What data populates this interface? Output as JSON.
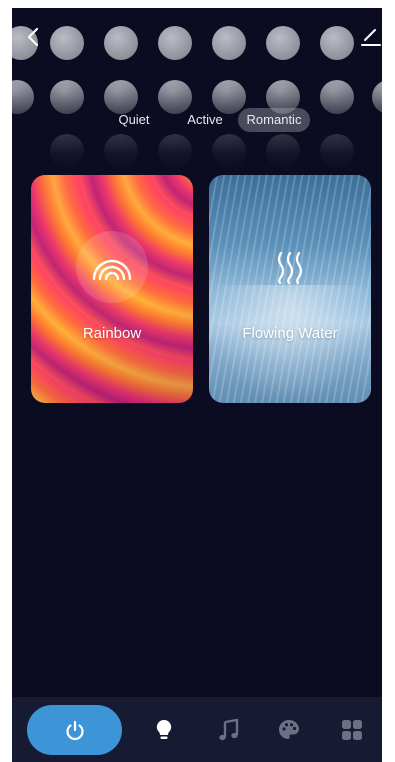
{
  "tabs": [
    {
      "label": "Quiet",
      "selected": false
    },
    {
      "label": "Active",
      "selected": false
    },
    {
      "label": "Romantic",
      "selected": true
    }
  ],
  "scenes": [
    {
      "label": "Rainbow",
      "icon": "rainbow-icon"
    },
    {
      "label": "Flowing Water",
      "icon": "water-waves-icon"
    }
  ],
  "bottom_nav": [
    {
      "name": "power",
      "icon": "power-icon",
      "active": true
    },
    {
      "name": "light",
      "icon": "bulb-icon"
    },
    {
      "name": "music",
      "icon": "music-note-icon"
    },
    {
      "name": "color",
      "icon": "palette-icon"
    },
    {
      "name": "scenes",
      "icon": "grid-icon"
    }
  ],
  "colors": {
    "background": "#0b0c22",
    "bottom_bar": "#171a33",
    "accent": "#3d95d8",
    "dot": "#9a9da5"
  },
  "header": {
    "back_icon": "chevron-left-icon",
    "edit_icon": "edit-pencil-icon"
  }
}
